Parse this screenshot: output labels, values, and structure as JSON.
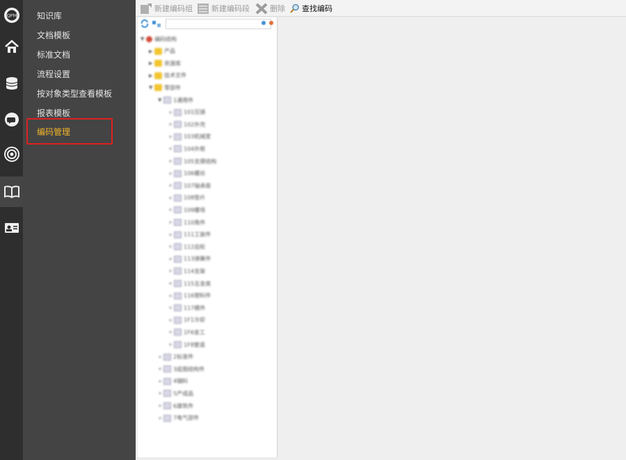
{
  "nav_icons": [
    "qpm-logo-icon",
    "home-icon",
    "database-icon",
    "chat-icon",
    "signal-icon",
    "book-icon",
    "id-card-icon"
  ],
  "menu": {
    "items": [
      {
        "label": "知识库"
      },
      {
        "label": "文档模板"
      },
      {
        "label": "标准文档"
      },
      {
        "label": "流程设置"
      },
      {
        "label": "按对象类型查看模板"
      },
      {
        "label": "报表模板"
      },
      {
        "label": "编码管理",
        "active": true
      }
    ]
  },
  "toolbar": {
    "new_group": "新建编码组",
    "new_segment": "新建编码段",
    "delete": "删除",
    "find": "查找编码"
  },
  "tree": {
    "nodes": [
      {
        "label": "编码结构",
        "level": 0,
        "icon": "root",
        "exp": "▼"
      },
      {
        "label": "产品",
        "level": 1,
        "icon": "folder",
        "exp": "▶"
      },
      {
        "label": "资源库",
        "level": 1,
        "icon": "folder",
        "exp": "▶"
      },
      {
        "label": "技术文件",
        "level": 1,
        "icon": "folder",
        "exp": "▶"
      },
      {
        "label": "零部件",
        "level": 1,
        "icon": "folder",
        "exp": "▼"
      },
      {
        "label": "1通用件",
        "level": 2,
        "icon": "doc",
        "exp": "▼"
      },
      {
        "label": "101压铸",
        "level": 3,
        "icon": "doc",
        "exp": "+"
      },
      {
        "label": "102外壳",
        "level": 3,
        "icon": "doc",
        "exp": "+"
      },
      {
        "label": "103机械室",
        "level": 3,
        "icon": "doc",
        "exp": "+"
      },
      {
        "label": "104外框",
        "level": 3,
        "icon": "doc",
        "exp": "+"
      },
      {
        "label": "105支撑结构",
        "level": 3,
        "icon": "doc",
        "exp": "+"
      },
      {
        "label": "106螺丝",
        "level": 3,
        "icon": "doc",
        "exp": "+"
      },
      {
        "label": "107轴承座",
        "level": 3,
        "icon": "doc",
        "exp": "+"
      },
      {
        "label": "108垫片",
        "level": 3,
        "icon": "doc",
        "exp": "+"
      },
      {
        "label": "109螺母",
        "level": 3,
        "icon": "doc",
        "exp": "+"
      },
      {
        "label": "110角件",
        "level": 3,
        "icon": "doc",
        "exp": "+"
      },
      {
        "label": "111工装件",
        "level": 3,
        "icon": "doc",
        "exp": "+"
      },
      {
        "label": "112齿轮",
        "level": 3,
        "icon": "doc",
        "exp": "+"
      },
      {
        "label": "113弹簧件",
        "level": 3,
        "icon": "doc",
        "exp": "+"
      },
      {
        "label": "114支架",
        "level": 3,
        "icon": "doc",
        "exp": "+"
      },
      {
        "label": "115五金类",
        "level": 3,
        "icon": "doc",
        "exp": "+"
      },
      {
        "label": "116塑料件",
        "level": 3,
        "icon": "doc",
        "exp": "+"
      },
      {
        "label": "117模件",
        "level": 3,
        "icon": "doc",
        "exp": "+"
      },
      {
        "label": "1F1冷却",
        "level": 3,
        "icon": "doc",
        "exp": "+"
      },
      {
        "label": "1F6金工",
        "level": 3,
        "icon": "doc",
        "exp": "+"
      },
      {
        "label": "1F8管道",
        "level": 3,
        "icon": "doc",
        "exp": "+"
      },
      {
        "label": "2标准件",
        "level": 2,
        "icon": "doc",
        "exp": "+"
      },
      {
        "label": "3底图结构件",
        "level": 2,
        "icon": "doc",
        "exp": "+"
      },
      {
        "label": "4辅料",
        "level": 2,
        "icon": "doc",
        "exp": "+"
      },
      {
        "label": "5产成品",
        "level": 2,
        "icon": "doc",
        "exp": "+"
      },
      {
        "label": "6建筑件",
        "level": 2,
        "icon": "doc",
        "exp": "+"
      },
      {
        "label": "7电气部件",
        "level": 2,
        "icon": "doc",
        "exp": "+"
      }
    ]
  }
}
